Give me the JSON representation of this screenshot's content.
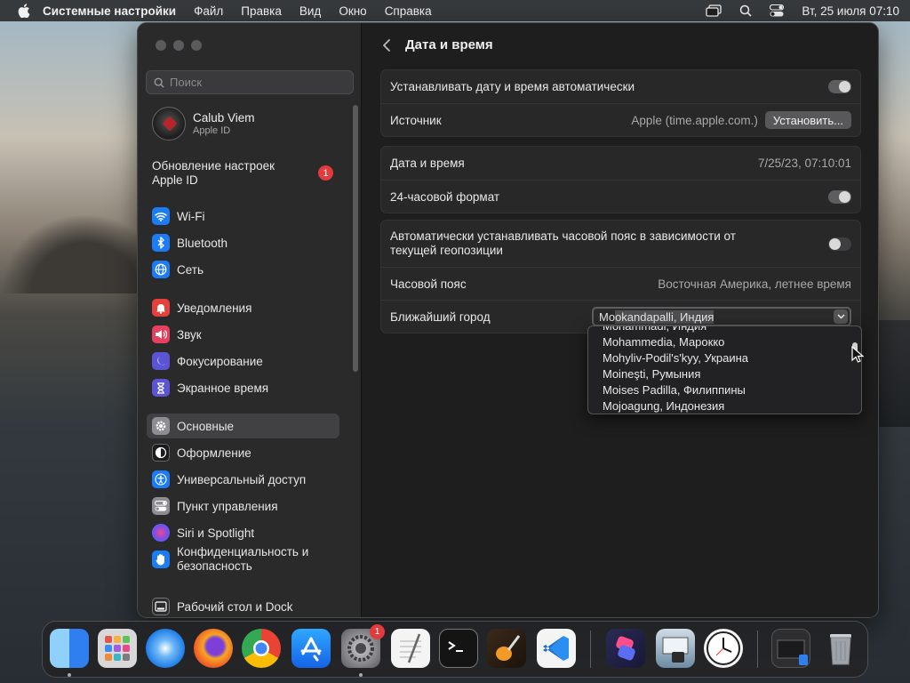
{
  "menubar": {
    "app_name": "Системные настройки",
    "items": [
      "Файл",
      "Правка",
      "Вид",
      "Окно",
      "Справка"
    ],
    "clock": "Вт, 25 июля  07:10"
  },
  "sidebar": {
    "search_placeholder": "Поиск",
    "user_name": "Calub Viem",
    "user_sub": "Apple ID",
    "update_label": "Обновление настроек Apple ID",
    "update_badge": "1",
    "items": [
      {
        "label": "Wi-Fi",
        "icon": "wifi-icon",
        "color": "#1b7cf5"
      },
      {
        "label": "Bluetooth",
        "icon": "bluetooth-icon",
        "color": "#1b7cf5"
      },
      {
        "label": "Сеть",
        "icon": "globe-icon",
        "color": "#1b7cf5"
      },
      {
        "label": "Уведомления",
        "icon": "bell-icon",
        "color": "#e5403b"
      },
      {
        "label": "Звук",
        "icon": "speaker-icon",
        "color": "#e5405f"
      },
      {
        "label": "Фокусирование",
        "icon": "moon-icon",
        "color": "#5b55d6"
      },
      {
        "label": "Экранное время",
        "icon": "hourglass-icon",
        "color": "#5b55d6"
      },
      {
        "label": "Основные",
        "icon": "gear-icon",
        "color": "#8d8d92"
      },
      {
        "label": "Оформление",
        "icon": "appearance-icon",
        "color": "#1c1c1e"
      },
      {
        "label": "Универсальный доступ",
        "icon": "accessibility-icon",
        "color": "#1b7cf5"
      },
      {
        "label": "Пункт управления",
        "icon": "control-center-icon",
        "color": "#8d8d92"
      },
      {
        "label": "Siri и Spotlight",
        "icon": "siri-icon",
        "color": "#b44fd8"
      },
      {
        "label": "Конфиденциальность и безопасность",
        "icon": "hand-icon",
        "color": "#1b7cf5"
      },
      {
        "label": "Рабочий стол и Dock",
        "icon": "dock-icon",
        "color": "#2c2c2e"
      }
    ]
  },
  "content": {
    "title": "Дата и время",
    "auto_time_label": "Устанавливать дату и время автоматически",
    "source_label": "Источник",
    "source_value": "Apple (time.apple.com.)",
    "set_button": "Установить...",
    "datetime_label": "Дата и время",
    "datetime_value": "7/25/23, 07:10:01",
    "format24_label": "24-часовой формат",
    "auto_tz_label": "Автоматически устанавливать часовой пояс в зависимости от текущей геопозиции",
    "tz_label": "Часовой пояс",
    "tz_value": "Восточная Америка, летнее время",
    "city_label": "Ближайший город",
    "city_typed": "Mo",
    "city_completion": "okandapalli, Индия",
    "toggles": {
      "auto_time": true,
      "format24": true,
      "auto_tz": false
    }
  },
  "dropdown": {
    "items": [
      "Mohammadi, Индия",
      "Mohammedia, Марокко",
      "Mohyliv-Podil's'kyy, Украина",
      "Moineşti, Румыния",
      "Moises Padilla, Филиппины",
      "Mojoagung, Индонезия"
    ]
  },
  "dock": {
    "apps": [
      {
        "icon": "finder-icon",
        "color": "#3d8ff0"
      },
      {
        "icon": "launchpad-icon",
        "color": "#d9d9d9"
      },
      {
        "icon": "safari-icon",
        "color": "#2f8df5"
      },
      {
        "icon": "firefox-icon",
        "color": "#f36a21"
      },
      {
        "icon": "chrome-icon",
        "color": "#e8e8e8"
      },
      {
        "icon": "app-store-icon",
        "color": "#1e8cf6"
      },
      {
        "icon": "system-settings-icon",
        "color": "#8c8c90"
      },
      {
        "icon": "textedit-icon",
        "color": "#f2f2f2"
      },
      {
        "icon": "terminal-icon",
        "color": "#1a1a1a"
      },
      {
        "icon": "garageband-icon",
        "color": "#f49a24"
      },
      {
        "icon": "vscode-icon",
        "color": "#2a8ff0"
      },
      {
        "icon": "shortcuts-icon",
        "color": "#6a57e8"
      },
      {
        "icon": "preview-icon",
        "color": "#b9c9d6"
      },
      {
        "icon": "clock-icon",
        "color": "#f5f5f5"
      },
      {
        "icon": "downloads-stack-icon",
        "color": "#3a3a3c"
      },
      {
        "icon": "trash-icon",
        "color": "#9da3a8"
      }
    ],
    "settings_badge": "1"
  }
}
